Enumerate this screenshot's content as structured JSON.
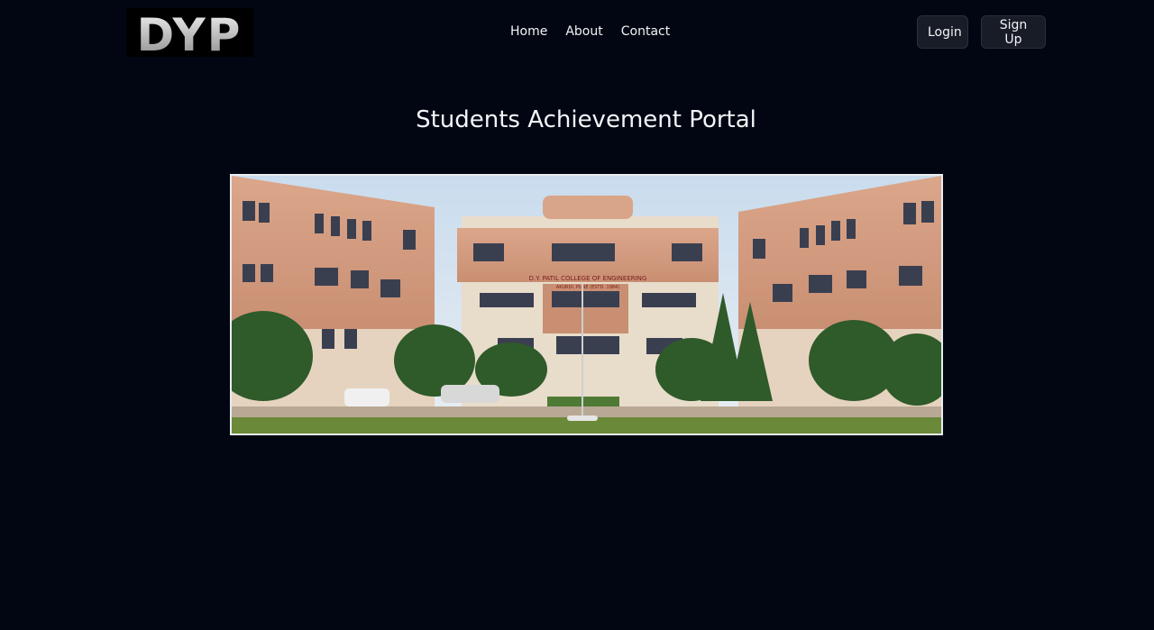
{
  "header": {
    "logo_text": "DYP",
    "nav": [
      {
        "label": "Home"
      },
      {
        "label": "About"
      },
      {
        "label": "Contact"
      }
    ],
    "login_label": "Login",
    "signup_label": "Sign Up"
  },
  "main": {
    "title": "Students Achievement Portal",
    "building_sign": "D.Y. PATIL COLLEGE OF ENGINEERING",
    "building_subsign": "AKURDI, PUNE (ESTD. 1984)"
  }
}
